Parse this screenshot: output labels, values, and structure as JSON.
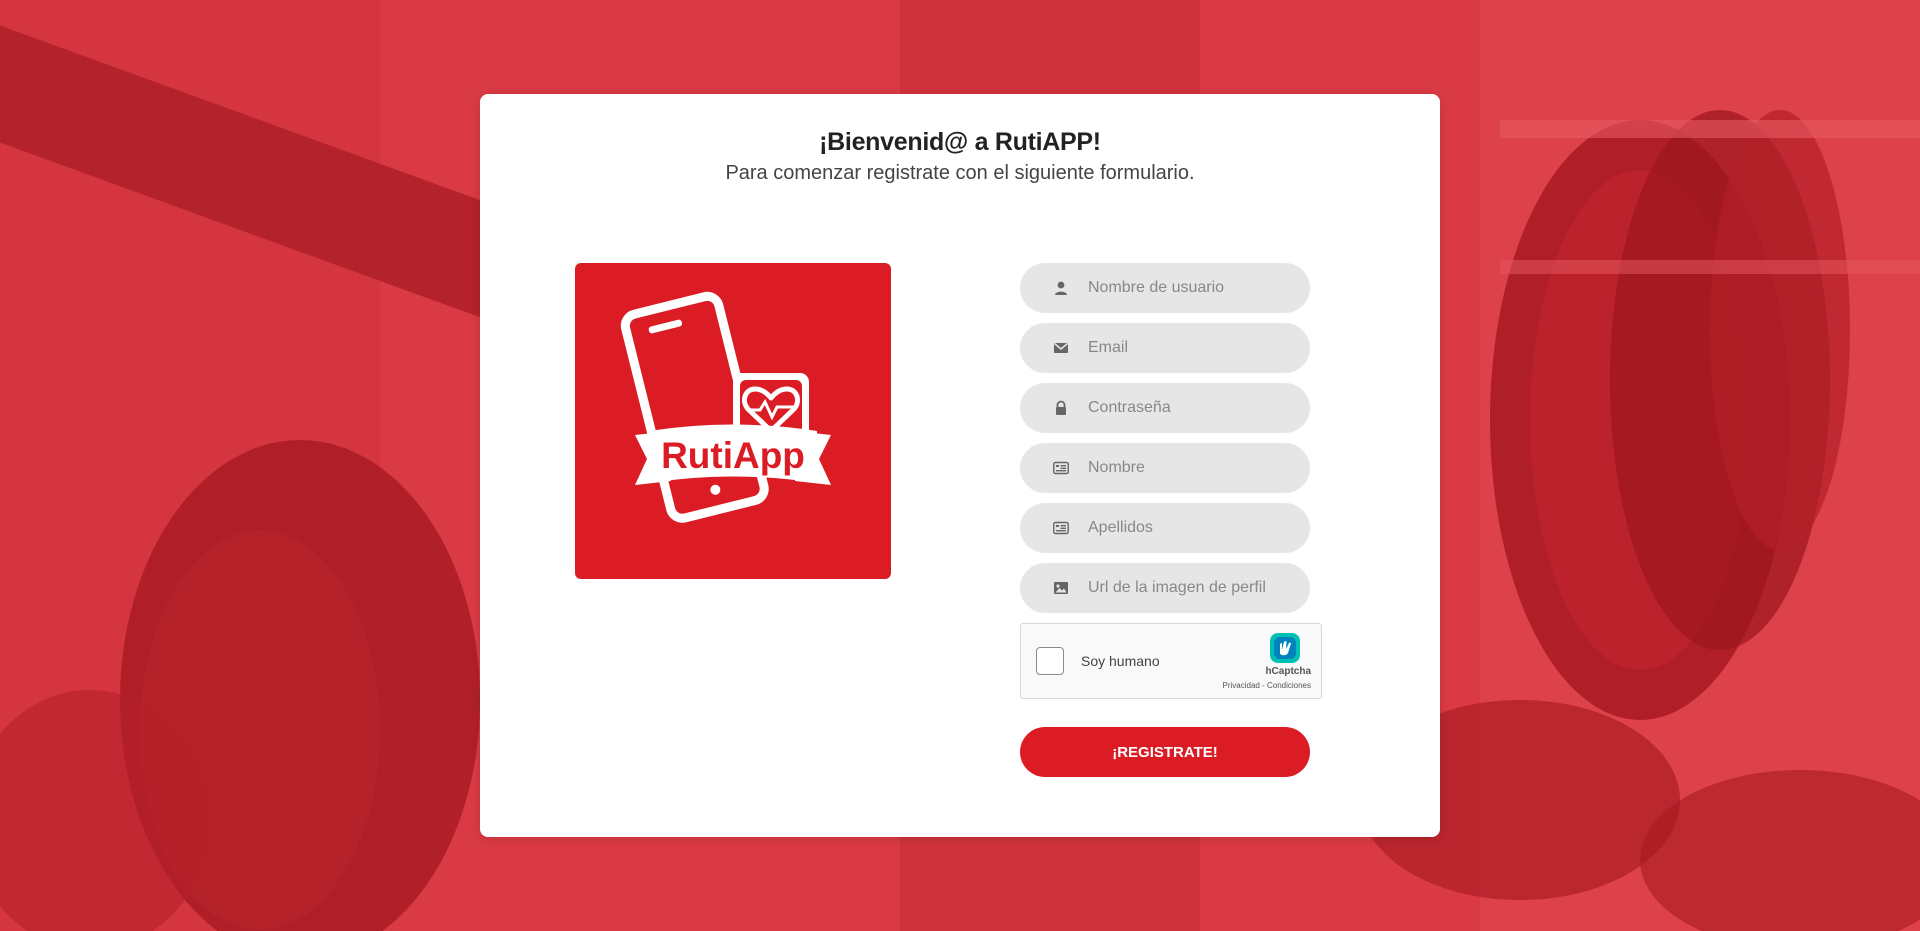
{
  "header": {
    "title": "¡Bienvenid@ a RutiAPP!",
    "subtitle": "Para comenzar registrate con el siguiente formulario."
  },
  "logo": {
    "text": "RutiApp",
    "background": "#dc1c24"
  },
  "form": {
    "fields": [
      {
        "placeholder": "Nombre de usuario",
        "icon": "user-icon",
        "value": ""
      },
      {
        "placeholder": "Email",
        "icon": "envelope-icon",
        "value": ""
      },
      {
        "placeholder": "Contraseña",
        "icon": "lock-icon",
        "value": ""
      },
      {
        "placeholder": "Nombre",
        "icon": "id-card-icon",
        "value": ""
      },
      {
        "placeholder": "Apellidos",
        "icon": "id-card-icon",
        "value": ""
      },
      {
        "placeholder": "Url de la imagen de perfil",
        "icon": "image-icon",
        "value": ""
      }
    ],
    "captcha": {
      "label": "Soy humano",
      "brand": "hCaptcha",
      "links": "Privacidad - Condiciones"
    },
    "submit_label": "¡REGISTRATE!"
  },
  "colors": {
    "accent": "#dc1c24",
    "background_overlay": "#d8363f",
    "field_bg": "#e6e6e6"
  }
}
